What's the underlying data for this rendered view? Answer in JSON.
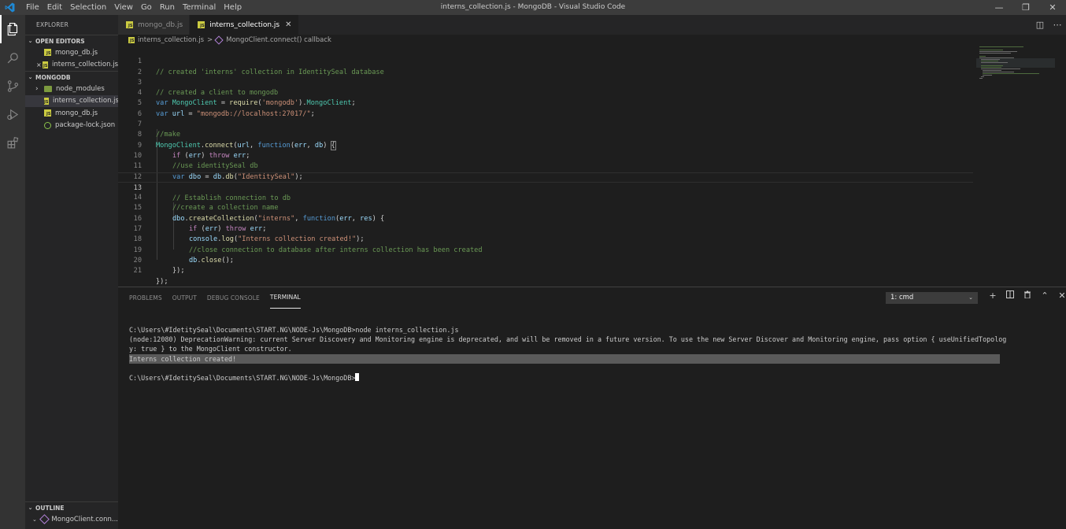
{
  "window": {
    "title": "interns_collection.js - MongoDB - Visual Studio Code",
    "menu": [
      "File",
      "Edit",
      "Selection",
      "View",
      "Go",
      "Run",
      "Terminal",
      "Help"
    ],
    "controls": {
      "minimize": "—",
      "restore": "❐",
      "close": "✕"
    }
  },
  "sidebar": {
    "title": "EXPLORER",
    "open_editors": {
      "label": "OPEN EDITORS",
      "items": [
        {
          "label": "mongo_db.js",
          "icon": "js-file-icon"
        },
        {
          "label": "interns_collection.js",
          "icon": "js-file-icon",
          "close": "×"
        }
      ]
    },
    "folder": {
      "label": "MONGODB",
      "items": [
        {
          "label": "node_modules",
          "icon": "folder-icon"
        },
        {
          "label": "interns_collection.js",
          "icon": "js-file-icon"
        },
        {
          "label": "mongo_db.js",
          "icon": "js-file-icon"
        },
        {
          "label": "package-lock.json",
          "icon": "json-file-icon"
        }
      ]
    },
    "outline": {
      "label": "OUTLINE",
      "items": [
        {
          "label": "MongoClient.conn..."
        }
      ]
    }
  },
  "tabs": [
    {
      "label": "mongo_db.js",
      "active": false
    },
    {
      "label": "interns_collection.js",
      "active": true,
      "close": "✕"
    }
  ],
  "breadcrumb": {
    "file": "interns_collection.js",
    "separator": ">",
    "symbol": "MongoClient.connect() callback"
  },
  "code_lines": [
    "1",
    "2",
    "3",
    "4",
    "5",
    "6",
    "7",
    "8",
    "9",
    "10",
    "11",
    "12",
    "13",
    "14",
    "15",
    "16",
    "17",
    "18",
    "19",
    "20",
    "21"
  ],
  "code": {
    "l1": "// created 'interns' collection in IdentitySeal database",
    "l3": "// created a client to mongodb",
    "l4a": "var",
    "l4b": "MongoClient",
    "l4c": " = ",
    "l4d": "require",
    "l4e": "(",
    "l4f": "'mongodb'",
    "l4g": ").",
    "l4h": "MongoClient",
    "l4i": ";",
    "l5a": "var",
    "l5b": "url",
    "l5c": " = ",
    "l5d": "\"mongodb://localhost:27017/\"",
    "l5e": ";",
    "l7": "//make",
    "l8a": "MongoClient",
    "l8b": ".",
    "l8c": "connect",
    "l8d": "(",
    "l8e": "url",
    "l8f": ", ",
    "l8g": "function",
    "l8h": "(",
    "l8i": "err",
    "l8j": ", ",
    "l8k": "db",
    "l8l": ") ",
    "l8m": "{",
    "l9a": "if",
    "l9b": " (",
    "l9c": "err",
    "l9d": ") ",
    "l9e": "throw",
    "l9f": " ",
    "l9g": "err",
    "l9h": ";",
    "l10": "//use identitySeal db",
    "l11a": "var",
    "l11b": "dbo",
    "l11c": " = ",
    "l11d": "db",
    "l11e": ".",
    "l11f": "db",
    "l11g": "(",
    "l11h": "\"IdentitySeal\"",
    "l11i": ");",
    "l13": "// Establish connection to db",
    "l14": "//create a collection name",
    "l15a": "dbo",
    "l15b": ".",
    "l15c": "createCollection",
    "l15d": "(",
    "l15e": "\"interns\"",
    "l15f": ", ",
    "l15g": "function",
    "l15h": "(",
    "l15i": "err",
    "l15j": ", ",
    "l15k": "res",
    "l15l": ") {",
    "l16a": "if",
    "l16b": " (",
    "l16c": "err",
    "l16d": ") ",
    "l16e": "throw",
    "l16f": " ",
    "l16g": "err",
    "l16h": ";",
    "l17a": "console",
    "l17b": ".",
    "l17c": "log",
    "l17d": "(",
    "l17e": "\"Interns collection created!\"",
    "l17f": ");",
    "l18": "//close connection to database after interns collection has been created",
    "l19a": "db",
    "l19b": ".",
    "l19c": "close",
    "l19d": "();",
    "l20": "});",
    "l21": "});"
  },
  "panel": {
    "tabs": [
      "PROBLEMS",
      "OUTPUT",
      "DEBUG CONSOLE",
      "TERMINAL"
    ],
    "active_tab": "TERMINAL",
    "terminal_select": "1: cmd",
    "actions": {
      "new": "+",
      "split": "◫",
      "kill": "🗑",
      "maximize": "⌃",
      "close": "✕"
    },
    "terminal_lines": [
      "C:\\Users\\#IdetitySeal\\Documents\\START.NG\\NODE-Js\\MongoDB>node interns_collection.js",
      "(node:12080) DeprecationWarning: current Server Discovery and Monitoring engine is deprecated, and will be removed in a future version. To use the new Server Discover and Monitoring engine, pass option { useUnifiedTopolog",
      "y: true } to the MongoClient constructor.",
      "Interns collection created!",
      "",
      "C:\\Users\\#IdetitySeal\\Documents\\START.NG\\NODE-Js\\MongoDB>"
    ]
  },
  "colors": {
    "titlebar": "#3c3c3c",
    "activitybar": "#333333",
    "sidebar": "#252526",
    "editor": "#1e1e1e",
    "vscode_blue": "#0078d4",
    "js_yellow": "#cbcb41"
  }
}
